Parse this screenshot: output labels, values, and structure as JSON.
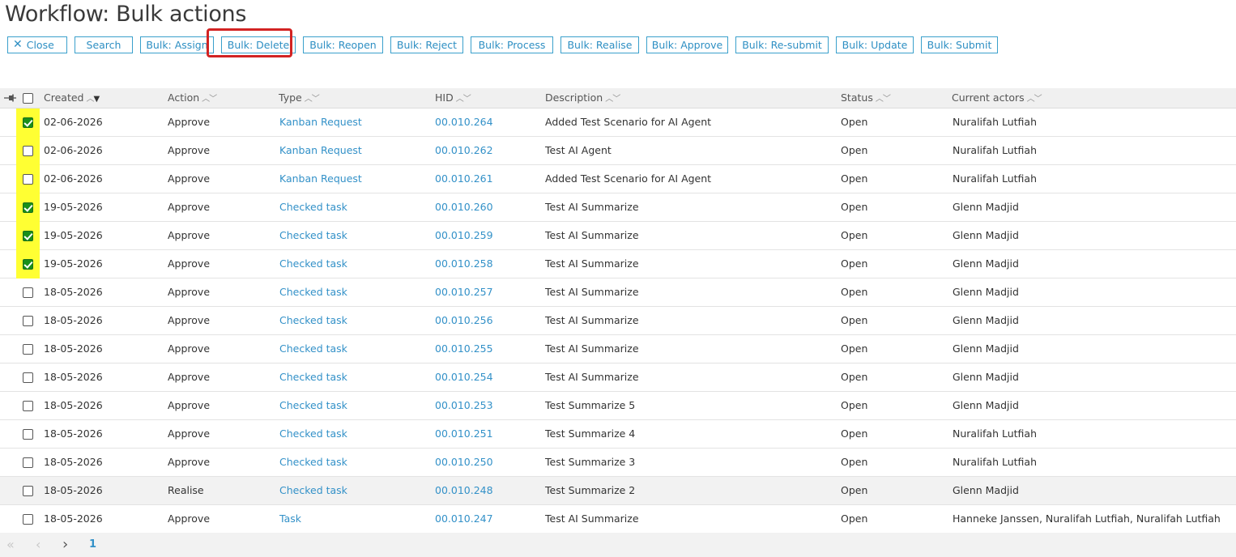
{
  "page": {
    "title": "Workflow: Bulk actions"
  },
  "toolbar": {
    "buttons": [
      {
        "name": "close-button",
        "label": "Close"
      },
      {
        "name": "search-button",
        "label": "Search"
      },
      {
        "name": "bulk-assign-button",
        "label": "Bulk: Assign"
      },
      {
        "name": "bulk-delete-button",
        "label": "Bulk: Delete"
      },
      {
        "name": "bulk-reopen-button",
        "label": "Bulk: Reopen"
      },
      {
        "name": "bulk-reject-button",
        "label": "Bulk: Reject"
      },
      {
        "name": "bulk-process-button",
        "label": "Bulk: Process"
      },
      {
        "name": "bulk-realise-button",
        "label": "Bulk: Realise"
      },
      {
        "name": "bulk-approve-button",
        "label": "Bulk: Approve"
      },
      {
        "name": "bulk-resubmit-button",
        "label": "Bulk: Re-submit"
      },
      {
        "name": "bulk-update-button",
        "label": "Bulk: Update"
      },
      {
        "name": "bulk-submit-button",
        "label": "Bulk: Submit"
      }
    ],
    "close_icon": "close-icon",
    "highlighted_button": "Bulk: Delete",
    "highlight_color": "#d22323"
  },
  "table": {
    "columns": [
      {
        "key": "created",
        "label": "Created"
      },
      {
        "key": "action",
        "label": "Action"
      },
      {
        "key": "type",
        "label": "Type"
      },
      {
        "key": "hid",
        "label": "HID"
      },
      {
        "key": "description",
        "label": "Description"
      },
      {
        "key": "status",
        "label": "Status"
      },
      {
        "key": "actors",
        "label": "Current actors"
      }
    ],
    "sorted_column": "created",
    "sort_direction": "descending",
    "rows": [
      {
        "checked": true,
        "highlight": true,
        "created": "02-06-2026",
        "action": "Approve",
        "type": "Kanban Request",
        "hid": "00.010.264",
        "description": "Added Test Scenario for AI Agent",
        "status": "Open",
        "actors": "Nuralifah Lutfiah"
      },
      {
        "checked": false,
        "highlight": true,
        "created": "02-06-2026",
        "action": "Approve",
        "type": "Kanban Request",
        "hid": "00.010.262",
        "description": "Test AI Agent",
        "status": "Open",
        "actors": "Nuralifah Lutfiah"
      },
      {
        "checked": false,
        "highlight": true,
        "created": "02-06-2026",
        "action": "Approve",
        "type": "Kanban Request",
        "hid": "00.010.261",
        "description": "Added Test Scenario for AI Agent",
        "status": "Open",
        "actors": "Nuralifah Lutfiah"
      },
      {
        "checked": true,
        "highlight": true,
        "created": "19-05-2026",
        "action": "Approve",
        "type": "Checked task",
        "hid": "00.010.260",
        "description": "Test AI Summarize",
        "status": "Open",
        "actors": "Glenn Madjid"
      },
      {
        "checked": true,
        "highlight": true,
        "created": "19-05-2026",
        "action": "Approve",
        "type": "Checked task",
        "hid": "00.010.259",
        "description": "Test AI Summarize",
        "status": "Open",
        "actors": "Glenn Madjid"
      },
      {
        "checked": true,
        "highlight": true,
        "created": "19-05-2026",
        "action": "Approve",
        "type": "Checked task",
        "hid": "00.010.258",
        "description": "Test AI Summarize",
        "status": "Open",
        "actors": "Glenn Madjid"
      },
      {
        "checked": false,
        "highlight": false,
        "created": "18-05-2026",
        "action": "Approve",
        "type": "Checked task",
        "hid": "00.010.257",
        "description": "Test AI Summarize",
        "status": "Open",
        "actors": "Glenn Madjid"
      },
      {
        "checked": false,
        "highlight": false,
        "created": "18-05-2026",
        "action": "Approve",
        "type": "Checked task",
        "hid": "00.010.256",
        "description": "Test AI Summarize",
        "status": "Open",
        "actors": "Glenn Madjid"
      },
      {
        "checked": false,
        "highlight": false,
        "created": "18-05-2026",
        "action": "Approve",
        "type": "Checked task",
        "hid": "00.010.255",
        "description": "Test AI Summarize",
        "status": "Open",
        "actors": "Glenn Madjid"
      },
      {
        "checked": false,
        "highlight": false,
        "created": "18-05-2026",
        "action": "Approve",
        "type": "Checked task",
        "hid": "00.010.254",
        "description": "Test AI Summarize",
        "status": "Open",
        "actors": "Glenn Madjid"
      },
      {
        "checked": false,
        "highlight": false,
        "created": "18-05-2026",
        "action": "Approve",
        "type": "Checked task",
        "hid": "00.010.253",
        "description": "Test Summarize 5",
        "status": "Open",
        "actors": "Glenn Madjid"
      },
      {
        "checked": false,
        "highlight": false,
        "created": "18-05-2026",
        "action": "Approve",
        "type": "Checked task",
        "hid": "00.010.251",
        "description": "Test Summarize 4",
        "status": "Open",
        "actors": "Nuralifah Lutfiah"
      },
      {
        "checked": false,
        "highlight": false,
        "created": "18-05-2026",
        "action": "Approve",
        "type": "Checked task",
        "hid": "00.010.250",
        "description": "Test Summarize 3",
        "status": "Open",
        "actors": "Nuralifah Lutfiah"
      },
      {
        "checked": false,
        "highlight": false,
        "hover": true,
        "created": "18-05-2026",
        "action": "Realise",
        "type": "Checked task",
        "hid": "00.010.248",
        "description": "Test Summarize 2",
        "status": "Open",
        "actors": "Glenn Madjid"
      },
      {
        "checked": false,
        "highlight": false,
        "created": "18-05-2026",
        "action": "Approve",
        "type": "Task",
        "hid": "00.010.247",
        "description": "Test AI Summarize",
        "status": "Open",
        "actors": "Hanneke Janssen, Nuralifah Lutfiah, Nuralifah Lutfiah"
      }
    ]
  },
  "pager": {
    "current_page": "1",
    "first_icon": "double-chevron-left-icon",
    "prev_icon": "chevron-left-icon",
    "next_icon": "chevron-right-icon"
  },
  "colors": {
    "accent": "#3391c8",
    "highlight_yellow": "#ffff33",
    "checkbox_checked": "#1a8f1a"
  }
}
